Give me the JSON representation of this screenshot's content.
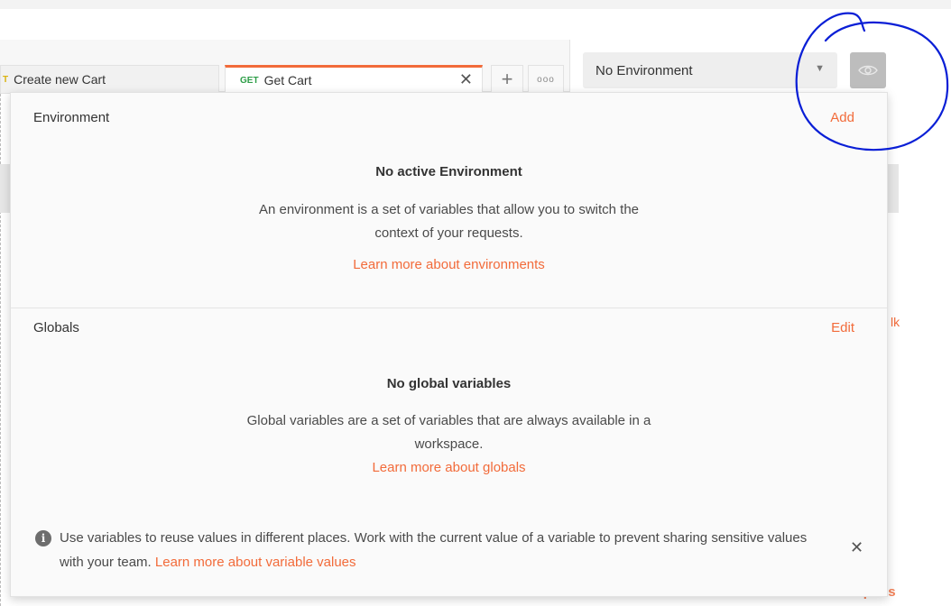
{
  "tabs": [
    {
      "method": "T",
      "method_color": "#d9b310",
      "label": "Create new Cart"
    },
    {
      "method": "GET",
      "method_color": "#2e9e48",
      "label": "Get Cart",
      "close": "✕"
    }
  ],
  "tab_add_label": "+",
  "tab_more_label": "ooo",
  "environment_selector": {
    "value": "No Environment",
    "caret": "▼"
  },
  "background_fragments": {
    "right_text": "lk",
    "save_text": "Save Respons"
  },
  "panel": {
    "environment": {
      "title": "Environment",
      "action": "Add",
      "heading": "No active Environment",
      "description_line1": "An environment is a set of variables that allow you to switch the",
      "description_line2": "context of your requests.",
      "link": "Learn more about environments"
    },
    "globals": {
      "title": "Globals",
      "action": "Edit",
      "heading": "No global variables",
      "description_line1": "Global variables are a set of variables that are always available in a",
      "description_line2": "workspace.",
      "link": "Learn more about globals"
    },
    "info": {
      "icon": "i",
      "text": "Use variables to reuse values in different places. Work with the current value of a variable to prevent sharing sensitive values with your team.",
      "link": "Learn more about variable values",
      "close": "✕"
    }
  },
  "colors": {
    "accent": "#f26b3a",
    "annotation": "#0a1fd6",
    "get": "#2e9e48"
  }
}
